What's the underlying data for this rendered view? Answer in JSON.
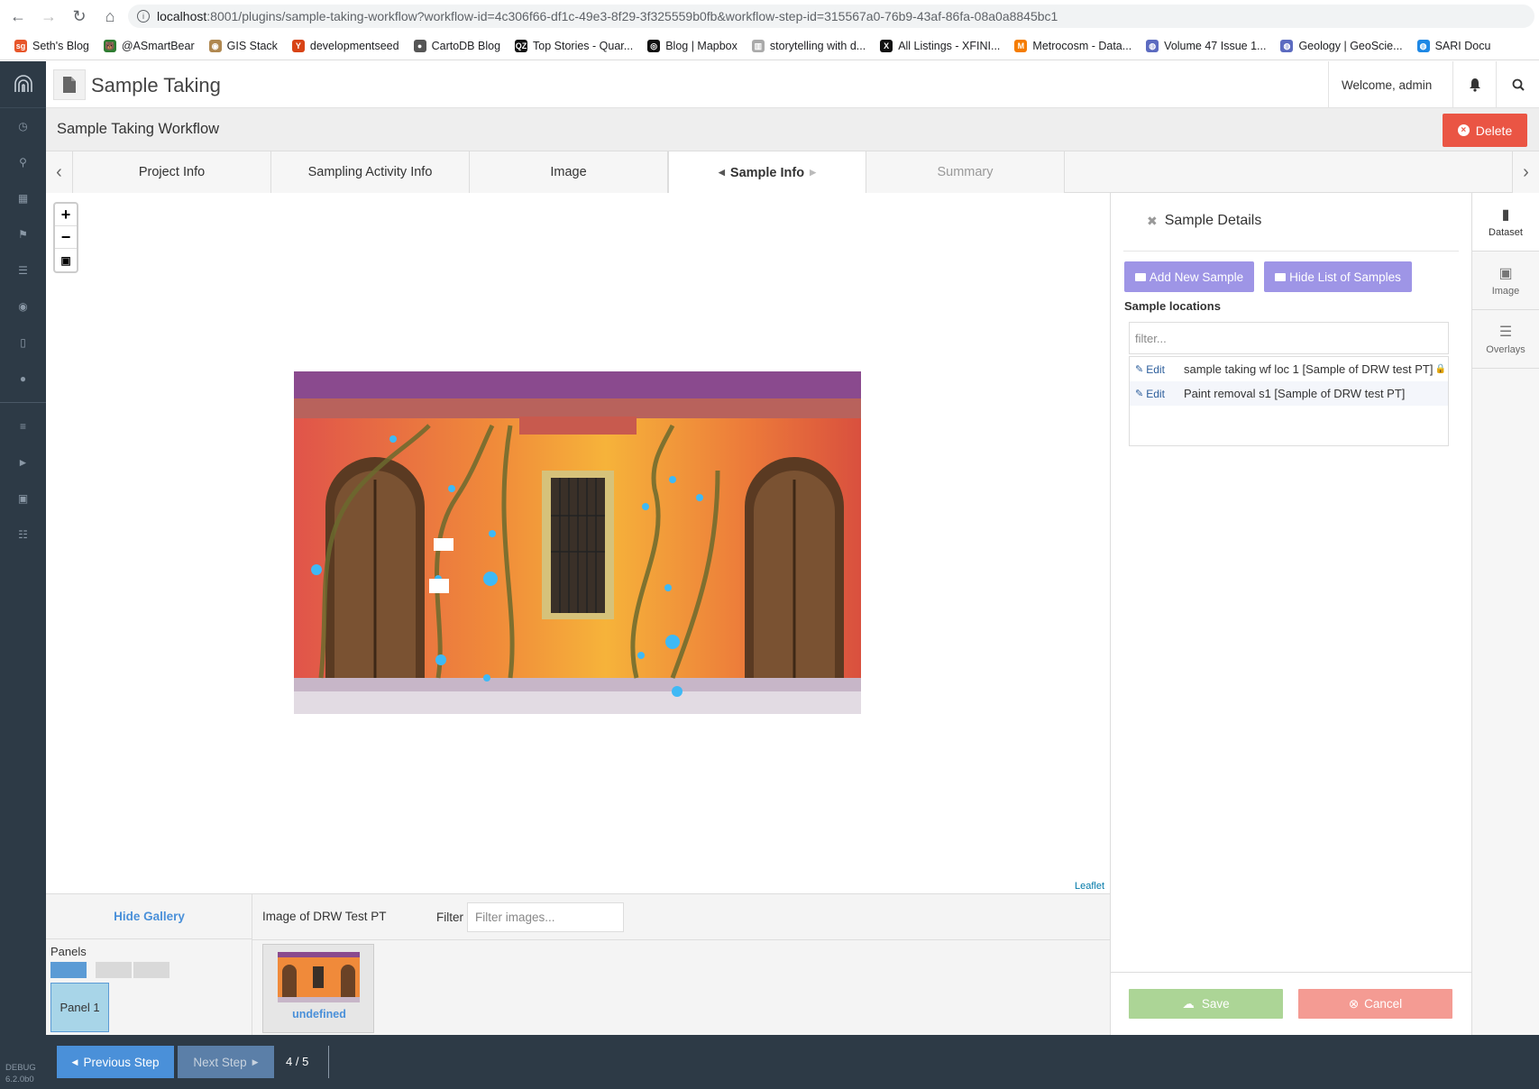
{
  "browser": {
    "url_host": "localhost",
    "url_path": ":8001/plugins/sample-taking-workflow?workflow-id=4c306f66-df1c-49e3-8f29-3f325559b0fb&workflow-step-id=315567a0-76b9-43af-86fa-08a0a8845bc1",
    "bookmarks": [
      {
        "label": "Seth's Blog",
        "icon": "sg",
        "color": "#e8562a"
      },
      {
        "label": "@ASmartBear",
        "icon": "bear",
        "color": "#2e7d32"
      },
      {
        "label": "GIS Stack",
        "icon": "gis",
        "color": "#b08850"
      },
      {
        "label": "developmentseed",
        "icon": "ds",
        "color": "#d84315"
      },
      {
        "label": "CartoDB Blog",
        "icon": "dot",
        "color": "#555555"
      },
      {
        "label": "Top Stories - Quar...",
        "icon": "qz",
        "color": "#111111"
      },
      {
        "label": "Blog | Mapbox",
        "icon": "mb",
        "color": "#111111"
      },
      {
        "label": "storytelling with d...",
        "icon": "bar",
        "color": "#aaaaaa"
      },
      {
        "label": "All Listings - XFINI...",
        "icon": "x",
        "color": "#111111"
      },
      {
        "label": "Metrocosm - Data...",
        "icon": "m",
        "color": "#f57c00"
      },
      {
        "label": "Volume 47 Issue 1...",
        "icon": "globe",
        "color": "#5c6bc0"
      },
      {
        "label": "Geology | GeoScie...",
        "icon": "globe",
        "color": "#5c6bc0"
      },
      {
        "label": "SARI Docu",
        "icon": "globe",
        "color": "#1e88e5"
      }
    ]
  },
  "header": {
    "title": "Sample Taking",
    "welcome": "Welcome, admin"
  },
  "workflow": {
    "title": "Sample Taking Workflow",
    "delete_label": "Delete",
    "tabs": [
      {
        "label": "Project Info",
        "state": "done"
      },
      {
        "label": "Sampling Activity Info",
        "state": "done"
      },
      {
        "label": "Image",
        "state": "done"
      },
      {
        "label": "Sample Info",
        "state": "active"
      },
      {
        "label": "Summary",
        "state": "disabled"
      }
    ]
  },
  "map": {
    "attribution": "Leaflet"
  },
  "sample_details": {
    "title": "Sample Details",
    "add_label": "Add New Sample",
    "hide_label": "Hide List of Samples",
    "locations_label": "Sample locations",
    "filter_placeholder": "filter...",
    "edit_label": "Edit",
    "samples": [
      {
        "name": "sample taking wf loc 1 [Sample of DRW test PT]",
        "locked": true
      },
      {
        "name": "Paint removal s1 [Sample of DRW test PT]",
        "locked": false
      }
    ],
    "save_label": "Save",
    "cancel_label": "Cancel"
  },
  "side_tabs": [
    {
      "label": "Dataset",
      "icon": "file-icon"
    },
    {
      "label": "Image",
      "icon": "image-icon"
    },
    {
      "label": "Overlays",
      "icon": "list-icon"
    }
  ],
  "gallery": {
    "hide_label": "Hide Gallery",
    "title": "Image of DRW Test PT",
    "filter_label": "Filter",
    "filter_placeholder": "Filter images...",
    "panels_label": "Panels",
    "panel_name": "Panel 1",
    "thumb_caption": "undefined"
  },
  "footer": {
    "prev_label": "Previous Step",
    "next_label": "Next Step",
    "step_count": "4 / 5"
  },
  "debug": {
    "label": "DEBUG",
    "version": "6.2.0b0"
  },
  "colors": {
    "sidebar": "#2d3a46",
    "accent": "#4a90d9",
    "delete": "#ea5544",
    "purple": "#9e95e6"
  }
}
